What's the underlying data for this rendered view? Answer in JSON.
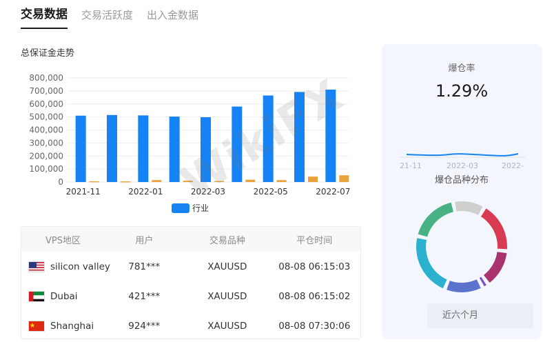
{
  "tabs": [
    "交易数据",
    "交易活跃度",
    "出入金数据"
  ],
  "chart": {
    "title": "总保证金走势",
    "legend": "行业",
    "primary_color": "#1683f4",
    "secondary_color": "#e8a33c"
  },
  "chart_data": {
    "type": "bar",
    "categories": [
      "2021-11",
      "2021-12",
      "2022-01",
      "2022-02",
      "2022-03",
      "2022-04",
      "2022-05",
      "2022-06",
      "2022-07"
    ],
    "tick_labels": [
      "2021-11",
      "2022-01",
      "2022-03",
      "2022-05",
      "2022-07"
    ],
    "y_ticks": [
      "0",
      "100,000",
      "200,000",
      "300,000",
      "400,000",
      "500,000",
      "600,000",
      "700,000",
      "800,000"
    ],
    "ylim": [
      0,
      800000
    ],
    "series": [
      {
        "name": "行业",
        "values": [
          510000,
          515000,
          512000,
          503000,
          498000,
          580000,
          665000,
          692000,
          710000
        ]
      },
      {
        "values": [
          6000,
          5000,
          15000,
          10000,
          8000,
          18000,
          15000,
          42000,
          52000
        ]
      }
    ]
  },
  "table": {
    "headers": [
      "VPS地区",
      "用户",
      "交易品种",
      "平仓时间"
    ],
    "rows": [
      {
        "flag": "us",
        "region": "silicon valley",
        "user": "781***",
        "symbol": "XAUUSD",
        "time": "08-08 06:15:03"
      },
      {
        "flag": "ae",
        "region": "Dubai",
        "user": "421***",
        "symbol": "XAUUSD",
        "time": "08-08 06:15:02"
      },
      {
        "flag": "cn",
        "region": "Shanghai",
        "user": "924***",
        "symbol": "XAUUSD",
        "time": "08-08 07:30:06"
      }
    ]
  },
  "side": {
    "liquidation_label": "爆仓率",
    "liquidation_value": "1.29%",
    "spark_ticks": [
      "21-11",
      "2022-03",
      "2022-"
    ],
    "distribution_label": "爆仓品种分布",
    "period_label": "近六个月",
    "donut_segments": [
      {
        "color": "#d83a52",
        "value": 16
      },
      {
        "color": "#a8336e",
        "value": 12
      },
      {
        "color": "#7b52c7",
        "value": 2
      },
      {
        "color": "#5b73cc",
        "value": 12
      },
      {
        "color": "#2bb1cf",
        "value": 20
      },
      {
        "color": "#48b284",
        "value": 16
      },
      {
        "color": "#cfcfcf",
        "value": 10
      }
    ]
  },
  "watermark": "WikiFX"
}
